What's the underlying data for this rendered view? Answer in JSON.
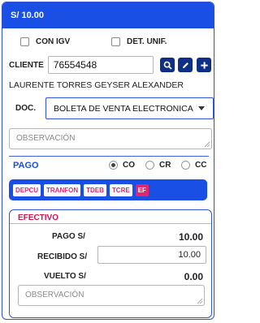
{
  "header": {
    "title": "S/ 10.00"
  },
  "options": {
    "con_igv": "CON IGV",
    "det_unif": "DET. UNIF."
  },
  "cliente": {
    "label": "CLIENTE",
    "value": "76554548",
    "name": "LAURENTE TORRES GEYSER ALEXANDER"
  },
  "doc": {
    "label": "DOC.",
    "selected": "BOLETA DE VENTA ELECTRONICA"
  },
  "observacion_placeholder": "OBSERVACIÓN",
  "pago": {
    "label": "PAGO",
    "radios": [
      {
        "label": "CO",
        "checked": true
      },
      {
        "label": "CR",
        "checked": false
      },
      {
        "label": "CC",
        "checked": false
      }
    ],
    "methods": [
      "DEPCU",
      "TRANFON",
      "TDEB",
      "TCRE",
      "EF"
    ],
    "active_method": "EF"
  },
  "efectivo": {
    "title": "EFECTIVO",
    "pago_label": "PAGO S/",
    "pago_value": "10.00",
    "recibido_label": "RECIBIDO S/",
    "recibido_value": "10.00",
    "vuelto_label": "VUELTO S/",
    "vuelto_value": "0.00",
    "observacion_placeholder": "OBSERVACIÓN"
  },
  "colors": {
    "primary": "#1a4fe6",
    "dark_button": "#0d2f86",
    "accent": "#e0266e",
    "efectivo_title": "#d8114a"
  }
}
